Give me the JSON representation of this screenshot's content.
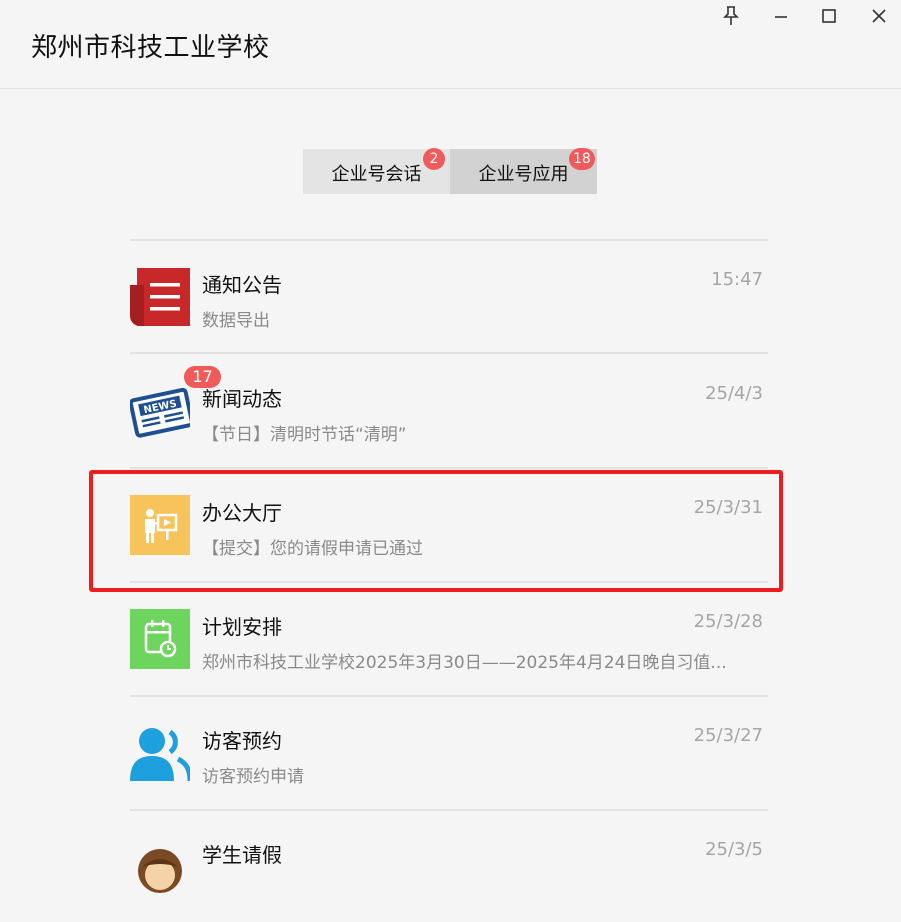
{
  "window": {
    "title": "郑州市科技工业学校",
    "controls": [
      "pin-icon",
      "minimize-icon",
      "maximize-icon",
      "close-icon"
    ]
  },
  "tabs": [
    {
      "label": "企业号会话",
      "badge": "2"
    },
    {
      "label": "企业号应用",
      "badge": "18"
    }
  ],
  "items": [
    {
      "title": "通知公告",
      "subtitle": "数据导出",
      "time": "15:47",
      "icon": "notice-icon"
    },
    {
      "title": "新闻动态",
      "subtitle": "【节日】清明时节话“清明”",
      "time": "25/4/3",
      "icon": "news-icon",
      "badge": "17"
    },
    {
      "title": "办公大厅",
      "subtitle": "【提交】您的请假申请已通过",
      "time": "25/3/31",
      "icon": "office-hall-icon"
    },
    {
      "title": "计划安排",
      "subtitle": "郑州市科技工业学校2025年3月30日——2025年4月24日晚自习值...",
      "time": "25/3/28",
      "icon": "calendar-icon"
    },
    {
      "title": "访客预约",
      "subtitle": "访客预约申请",
      "time": "25/3/27",
      "icon": "visitor-icon"
    },
    {
      "title": "学生请假",
      "subtitle": "",
      "time": "25/3/5",
      "icon": "student-leave-icon"
    }
  ],
  "colors": {
    "badge": "#f05a5a",
    "highlight": "#ee1c1c",
    "notice": "#c8282a",
    "news": "#1f4f93",
    "office": "#f7c35b",
    "calendar": "#6dd45e",
    "visitor": "#1ea0de"
  }
}
